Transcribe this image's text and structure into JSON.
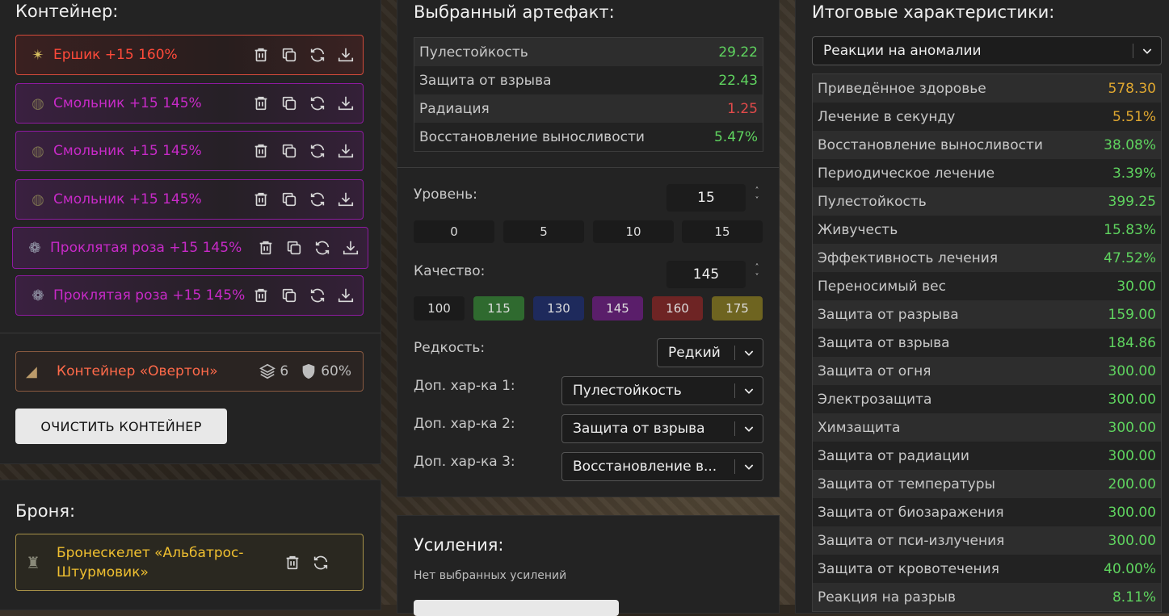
{
  "container": {
    "title": "Контейнер:",
    "artifacts": [
      {
        "name": "Ершик +15 160%",
        "icon": "spiky-artifact-icon"
      },
      {
        "name": "Смольник +15 145%",
        "icon": "resin-artifact-icon"
      },
      {
        "name": "Смольник +15 145%",
        "icon": "resin-artifact-icon"
      },
      {
        "name": "Смольник +15 145%",
        "icon": "resin-artifact-icon"
      },
      {
        "name": "Проклятая роза +15 145%",
        "icon": "rose-artifact-icon"
      },
      {
        "name": "Проклятая роза +15 145%",
        "icon": "rose-artifact-icon"
      }
    ],
    "container_item": {
      "name": "Контейнер «Овертон»",
      "slots": "6",
      "protection": "60%"
    },
    "clear_button": "ОЧИСТИТЬ КОНТЕЙНЕР"
  },
  "armor": {
    "title": "Броня:",
    "name": "Бронескелет «Альбатрос-Штурмовик»"
  },
  "selected": {
    "title": "Выбранный артефакт:",
    "stats": [
      {
        "label": "Пулестойкость",
        "value": "29.22",
        "color": "#5fd45f"
      },
      {
        "label": "Защита от взрыва",
        "value": "22.43",
        "color": "#5fd45f"
      },
      {
        "label": "Радиация",
        "value": "1.25",
        "color": "#e04a4a"
      },
      {
        "label": "Восстановление выносливости",
        "value": "5.47%",
        "color": "#5fd45f"
      }
    ],
    "level_label": "Уровень:",
    "level_value": "15",
    "level_buttons": [
      "0",
      "5",
      "10",
      "15"
    ],
    "quality_label": "Качество:",
    "quality_value": "145",
    "quality_buttons": [
      {
        "label": "100",
        "color": "#1b1b1b"
      },
      {
        "label": "115",
        "color": "#2f6a2f"
      },
      {
        "label": "130",
        "color": "#1e2a5c"
      },
      {
        "label": "145",
        "color": "#5a1e6a"
      },
      {
        "label": "160",
        "color": "#6e2424"
      },
      {
        "label": "175",
        "color": "#6e6420"
      }
    ],
    "rarity_label": "Редкость:",
    "rarity_value": "Редкий",
    "extra1_label": "Доп. хар-ка 1:",
    "extra1_value": "Пулестойкость",
    "extra2_label": "Доп. хар-ка 2:",
    "extra2_value": "Защита от взрыва",
    "extra3_label": "Доп. хар-ка 3:",
    "extra3_value": "Восстановление в..."
  },
  "boosts": {
    "title": "Усиления:",
    "empty": "Нет выбранных усилений"
  },
  "totals": {
    "title": "Итоговые характеристики:",
    "filter": "Реакции на аномалии",
    "rows": [
      {
        "label": "Приведённое здоровье",
        "value": "578.30",
        "color": "#e0a830"
      },
      {
        "label": "Лечение в секунду",
        "value": "5.51%",
        "color": "#e0a830"
      },
      {
        "label": "Восстановление выносливости",
        "value": "38.08%",
        "color": "#5fd45f"
      },
      {
        "label": "Периодическое лечение",
        "value": "3.39%",
        "color": "#5fd45f"
      },
      {
        "label": "Пулестойкость",
        "value": "399.25",
        "color": "#5fd45f"
      },
      {
        "label": "Живучесть",
        "value": "15.83%",
        "color": "#5fd45f"
      },
      {
        "label": "Эффективность лечения",
        "value": "47.52%",
        "color": "#5fd45f"
      },
      {
        "label": "Переносимый вес",
        "value": "30.00",
        "color": "#5fd45f"
      },
      {
        "label": "Защита от разрыва",
        "value": "159.00",
        "color": "#5fd45f"
      },
      {
        "label": "Защита от взрыва",
        "value": "184.86",
        "color": "#5fd45f"
      },
      {
        "label": "Защита от огня",
        "value": "300.00",
        "color": "#5fd45f"
      },
      {
        "label": "Электрозащита",
        "value": "300.00",
        "color": "#5fd45f"
      },
      {
        "label": "Химзащита",
        "value": "300.00",
        "color": "#5fd45f"
      },
      {
        "label": "Защита от радиации",
        "value": "300.00",
        "color": "#5fd45f"
      },
      {
        "label": "Защита от температуры",
        "value": "200.00",
        "color": "#5fd45f"
      },
      {
        "label": "Защита от биозаражения",
        "value": "300.00",
        "color": "#5fd45f"
      },
      {
        "label": "Защита от пси-излучения",
        "value": "300.00",
        "color": "#5fd45f"
      },
      {
        "label": "Защита от кровотечения",
        "value": "40.00%",
        "color": "#5fd45f"
      },
      {
        "label": "Реакция на разрыв",
        "value": "8.11%",
        "color": "#5fd45f"
      }
    ]
  }
}
